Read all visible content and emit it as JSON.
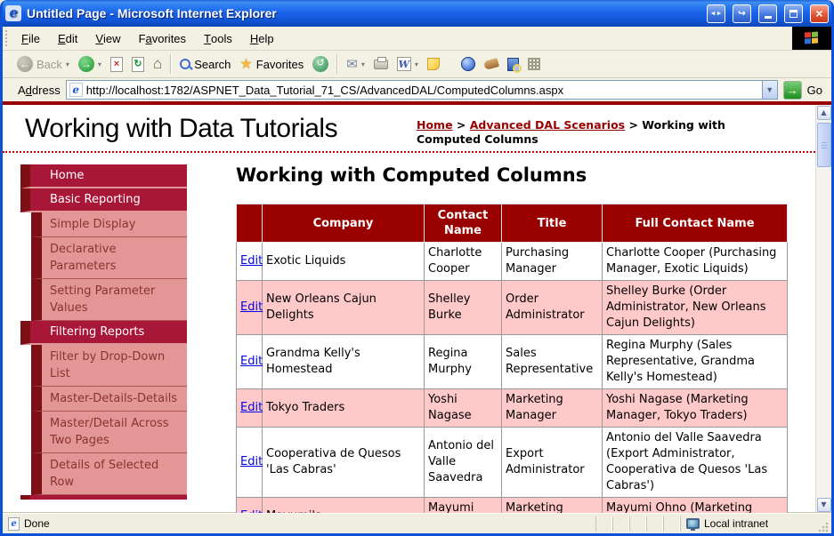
{
  "window": {
    "title": "Untitled Page - Microsoft Internet Explorer"
  },
  "menu": {
    "items": [
      {
        "pre": "",
        "accel": "F",
        "post": "ile"
      },
      {
        "pre": "",
        "accel": "E",
        "post": "dit"
      },
      {
        "pre": "",
        "accel": "V",
        "post": "iew"
      },
      {
        "pre": "F",
        "accel": "a",
        "post": "vorites"
      },
      {
        "pre": "",
        "accel": "T",
        "post": "ools"
      },
      {
        "pre": "",
        "accel": "H",
        "post": "elp"
      }
    ]
  },
  "toolbar": {
    "back_label": "Back",
    "search_label": "Search",
    "favorites_label": "Favorites"
  },
  "address": {
    "label_pre": "A",
    "label_accel": "d",
    "label_post": "dress",
    "url": "http://localhost:1782/ASPNET_Data_Tutorial_71_CS/AdvancedDAL/ComputedColumns.aspx",
    "go_label": "Go"
  },
  "icons": {
    "back_arrow": "←",
    "forward_arrow": "→",
    "stop_x": "×",
    "refresh": "↻",
    "home": "⌂",
    "star": "★",
    "history": "↺",
    "mail": "✉",
    "word": "W",
    "dropdown": "▾",
    "scroll_up": "▲",
    "scroll_down": "▼",
    "go_arrow": "→",
    "win_arrows": "◄►",
    "win_popout": "↪",
    "close_x": "×",
    "ie_e": "e"
  },
  "page": {
    "site_title": "Working with Data Tutorials",
    "breadcrumb": {
      "home": "Home",
      "sep1": " > ",
      "section": "Advanced DAL Scenarios",
      "sep2": " > ",
      "current": "Working with Computed Columns"
    },
    "sidebar": {
      "items": [
        {
          "label": "Home",
          "type": "section"
        },
        {
          "label": "Basic Reporting",
          "type": "section"
        },
        {
          "label": "Simple Display",
          "type": "sub"
        },
        {
          "label": "Declarative Parameters",
          "type": "sub"
        },
        {
          "label": "Setting Parameter Values",
          "type": "sub"
        },
        {
          "label": "Filtering Reports",
          "type": "section"
        },
        {
          "label": "Filter by Drop-Down List",
          "type": "sub"
        },
        {
          "label": "Master-Details-Details",
          "type": "sub"
        },
        {
          "label": "Master/Detail Across Two Pages",
          "type": "sub"
        },
        {
          "label": "Details of Selected Row",
          "type": "sub"
        }
      ]
    },
    "main": {
      "heading": "Working with Computed Columns",
      "table": {
        "headers": [
          "",
          "Company",
          "Contact Name",
          "Title",
          "Full Contact Name"
        ],
        "edit_label": "Edit",
        "rows": [
          {
            "company": "Exotic Liquids",
            "contact": "Charlotte Cooper",
            "title": "Purchasing Manager",
            "full_name": "Charlotte Cooper (Purchasing Manager, Exotic Liquids)"
          },
          {
            "company": "New Orleans Cajun Delights",
            "contact": "Shelley Burke",
            "title": "Order Administrator",
            "full_name": "Shelley Burke (Order Administrator, New Orleans Cajun Delights)"
          },
          {
            "company": "Grandma Kelly's Homestead",
            "contact": "Regina Murphy",
            "title": "Sales Representative",
            "full_name": "Regina Murphy (Sales Representative, Grandma Kelly's Homestead)"
          },
          {
            "company": "Tokyo Traders",
            "contact": "Yoshi Nagase",
            "title": "Marketing Manager",
            "full_name": "Yoshi Nagase (Marketing Manager, Tokyo Traders)"
          },
          {
            "company": "Cooperativa de Quesos 'Las Cabras'",
            "contact": "Antonio del Valle Saavedra",
            "title": "Export Administrator",
            "full_name": "Antonio del Valle Saavedra (Export Administrator, Cooperativa de Quesos 'Las Cabras')"
          },
          {
            "company": "Mayumi's",
            "contact": "Mayumi Ohno",
            "title": "Marketing Representative",
            "full_name": "Mayumi Ohno (Marketing Representative, Mayumi's)"
          }
        ]
      }
    }
  },
  "status": {
    "left": "Done",
    "zone": "Local intranet"
  },
  "colors": {
    "theme_dark_red": "#990000",
    "sidebar_section_red": "#A81638",
    "sidebar_strip_maroon": "#7D1014",
    "sidebar_pink": "#E39696",
    "alt_row_pink": "#FFC9C9",
    "link_blue": "#0000EE",
    "xp_titlebar_blue": "#1961E8",
    "chrome_tan": "#F3F1E4"
  }
}
